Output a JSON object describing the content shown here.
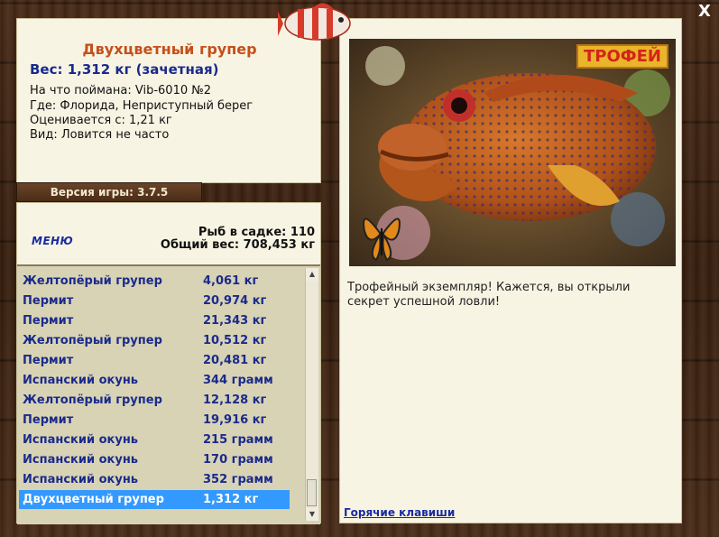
{
  "info": {
    "title": "Двухцветный групер",
    "weight": "Вес: 1,312 кг (зачетная)",
    "lines": [
      "На что поймана: Vib-6010 №2",
      "Где: Флорида, Неприступный берег",
      "Оценивается с: 1,21 кг",
      "Вид: Ловится не часто"
    ]
  },
  "version": "Версия игры: 3.7.5",
  "menu_label": "МЕНЮ",
  "stats": {
    "count": "Рыб в садке: 110",
    "total": "Общий вес: 708,453 кг"
  },
  "rows": [
    {
      "name": "Желтопёрый групер",
      "weight": "4,061 кг"
    },
    {
      "name": "Пермит",
      "weight": "20,974 кг"
    },
    {
      "name": "Пермит",
      "weight": "21,343 кг"
    },
    {
      "name": "Желтопёрый групер",
      "weight": "10,512 кг"
    },
    {
      "name": "Пермит",
      "weight": "20,481 кг"
    },
    {
      "name": "Испанский окунь",
      "weight": "344 грамм"
    },
    {
      "name": "Желтопёрый групер",
      "weight": "12,128 кг"
    },
    {
      "name": "Пермит",
      "weight": "19,916 кг"
    },
    {
      "name": "Испанский окунь",
      "weight": "215 грамм"
    },
    {
      "name": "Испанский окунь",
      "weight": "170 грамм"
    },
    {
      "name": "Испанский окунь",
      "weight": "352 грамм"
    },
    {
      "name": "Двухцветный групер",
      "weight": "1,312 кг"
    }
  ],
  "selected_row": 11,
  "trophy_label": "ТРОФЕЙ",
  "description": "Трофейный экземпляр! Кажется, вы открыли секрет успешной ловли!",
  "hotkeys": "Горячие клавиши",
  "close_glyph": "X",
  "colors": {
    "accent": "#1a2a8c",
    "title": "#c4501a",
    "selection": "#3399ff"
  }
}
